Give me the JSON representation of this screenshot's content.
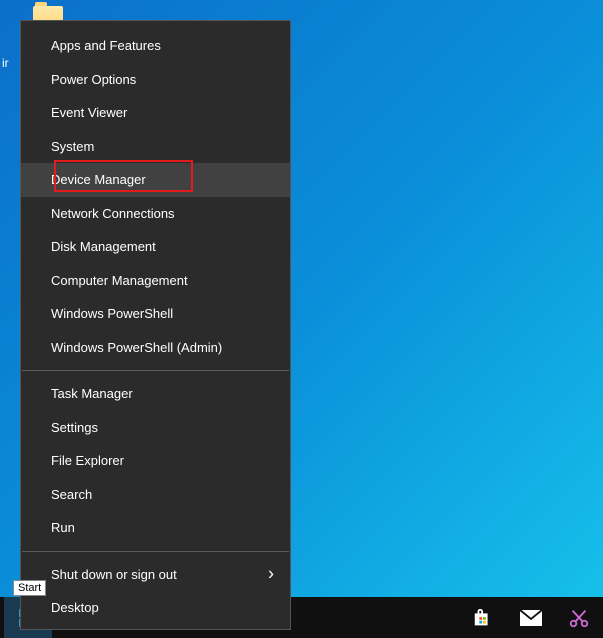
{
  "desktop": {
    "icon_label_partial": "ir"
  },
  "contextMenu": {
    "groups": [
      [
        {
          "id": "apps-features",
          "label": "Apps and Features",
          "hover": false
        },
        {
          "id": "power-options",
          "label": "Power Options",
          "hover": false
        },
        {
          "id": "event-viewer",
          "label": "Event Viewer",
          "hover": false
        },
        {
          "id": "system",
          "label": "System",
          "hover": false
        },
        {
          "id": "device-manager",
          "label": "Device Manager",
          "hover": true,
          "highlight": true
        },
        {
          "id": "network-connections",
          "label": "Network Connections",
          "hover": false
        },
        {
          "id": "disk-management",
          "label": "Disk Management",
          "hover": false
        },
        {
          "id": "computer-management",
          "label": "Computer Management",
          "hover": false
        },
        {
          "id": "windows-powershell",
          "label": "Windows PowerShell",
          "hover": false
        },
        {
          "id": "windows-powershell-admin",
          "label": "Windows PowerShell (Admin)",
          "hover": false
        }
      ],
      [
        {
          "id": "task-manager",
          "label": "Task Manager",
          "hover": false
        },
        {
          "id": "settings",
          "label": "Settings",
          "hover": false
        },
        {
          "id": "file-explorer",
          "label": "File Explorer",
          "hover": false
        },
        {
          "id": "search",
          "label": "Search",
          "hover": false
        },
        {
          "id": "run",
          "label": "Run",
          "hover": false
        }
      ],
      [
        {
          "id": "shutdown-signout",
          "label": "Shut down or sign out",
          "hover": false,
          "submenu": true
        },
        {
          "id": "desktop",
          "label": "Desktop",
          "hover": false
        }
      ]
    ]
  },
  "tooltip": {
    "start": "Start"
  },
  "taskbar": {
    "items": [
      {
        "id": "start",
        "icon": "windows-logo",
        "active": true
      },
      {
        "id": "search",
        "icon": "search-icon"
      },
      {
        "id": "task-view",
        "icon": "task-view-icon"
      },
      {
        "id": "edge",
        "icon": "edge-icon"
      },
      {
        "id": "explorer",
        "icon": "explorer-icon"
      },
      {
        "id": "store",
        "icon": "store-icon"
      },
      {
        "id": "mail",
        "icon": "mail-icon"
      },
      {
        "id": "snip",
        "icon": "snip-icon"
      }
    ]
  }
}
